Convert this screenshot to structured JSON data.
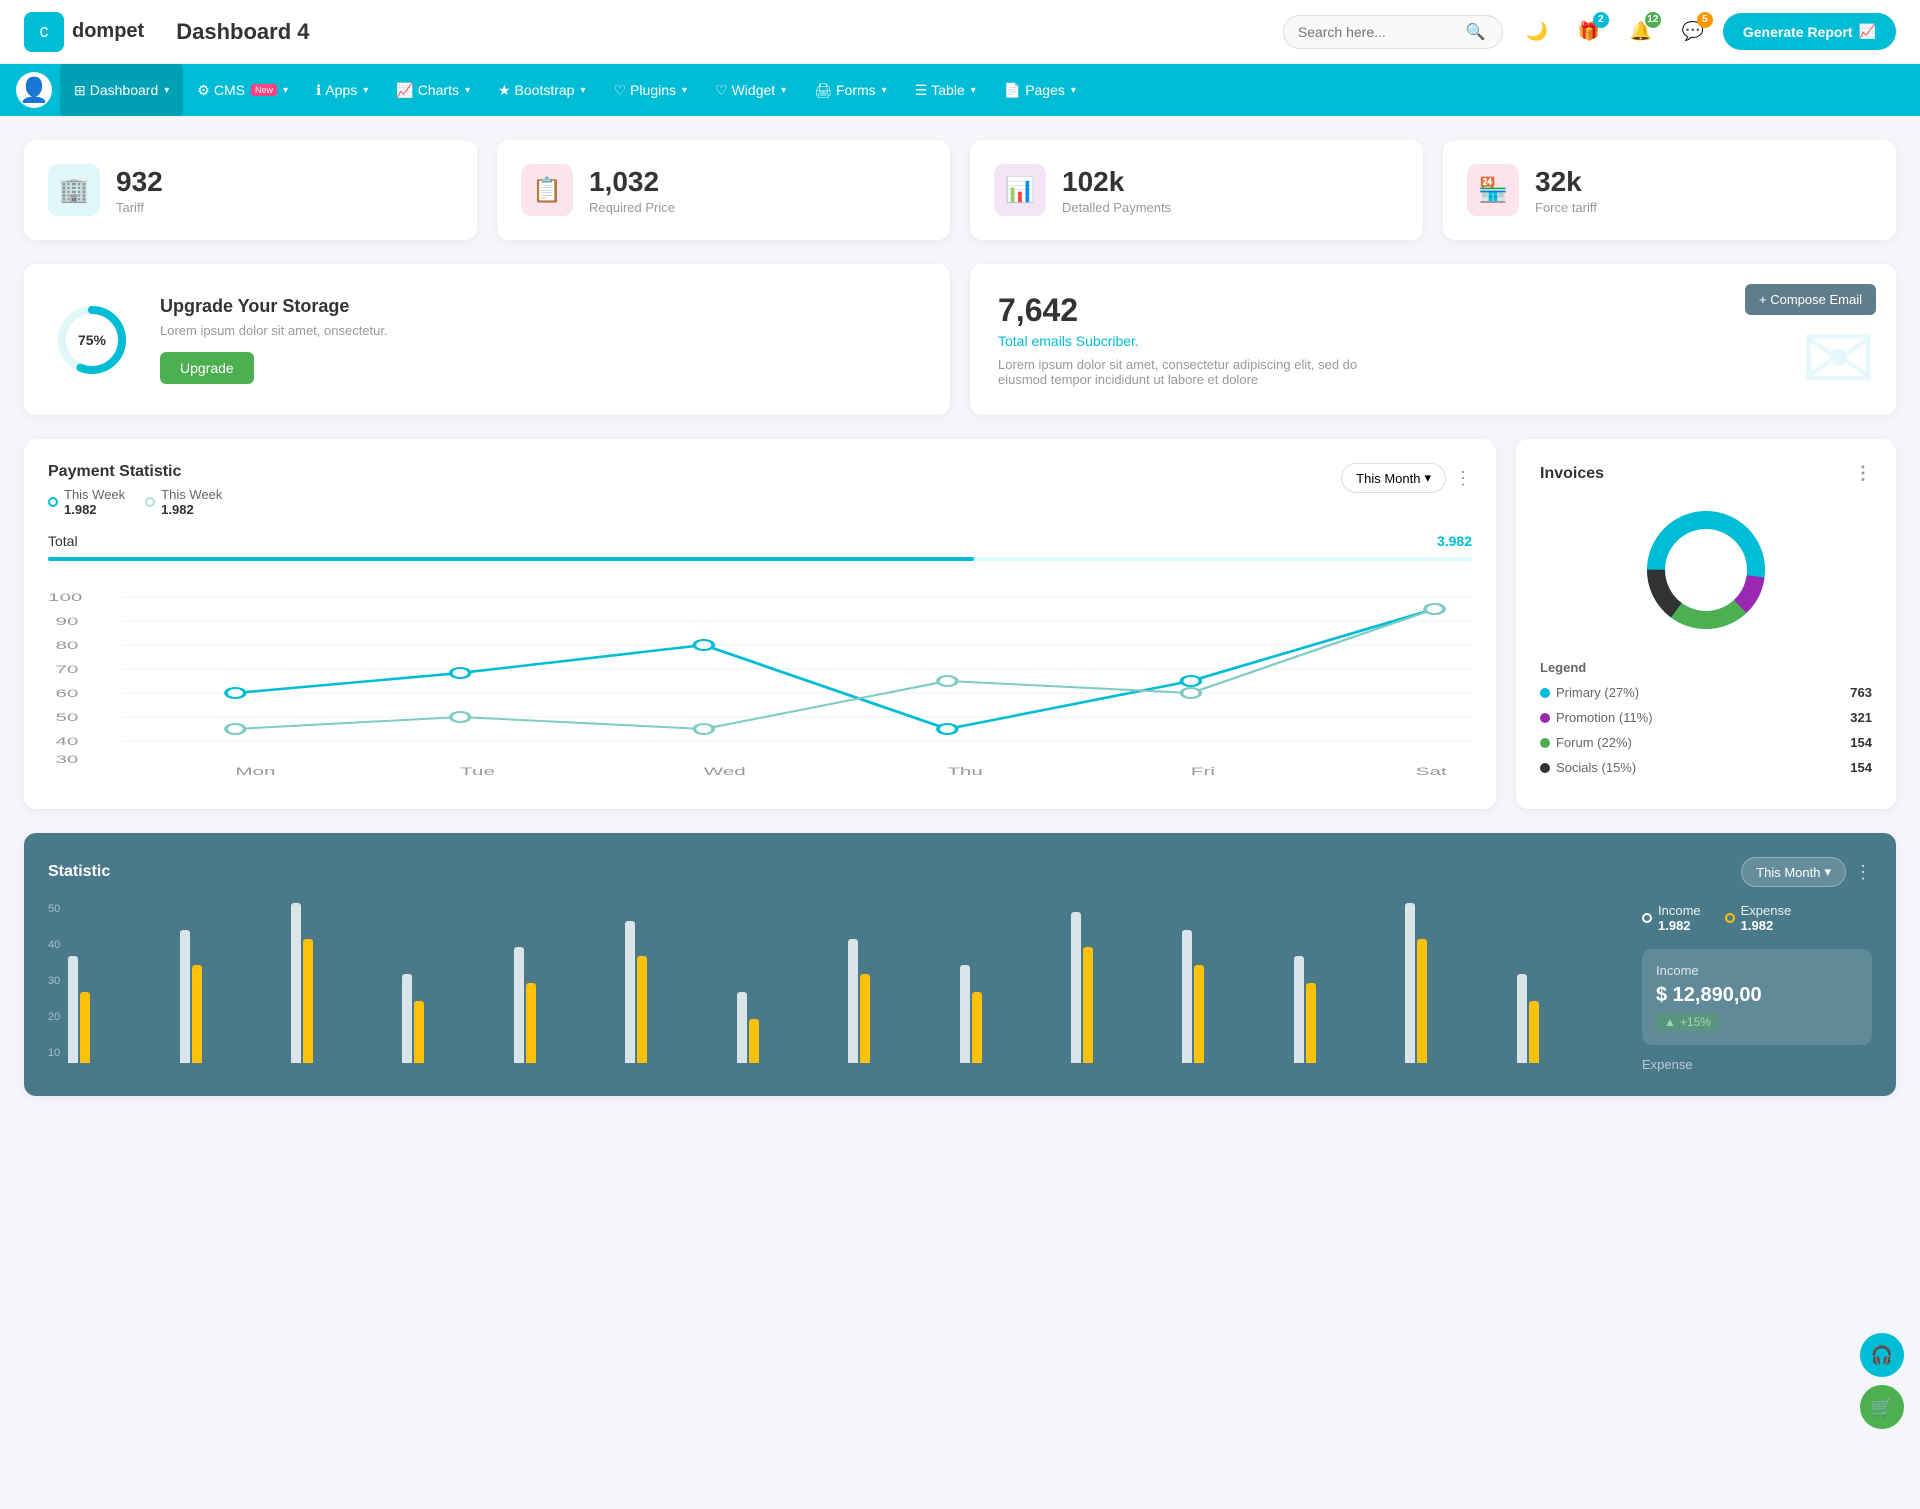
{
  "header": {
    "logo_icon": "💼",
    "logo_text": "dompet",
    "page_title": "Dashboard 4",
    "search_placeholder": "Search here...",
    "generate_btn": "Generate Report",
    "icons": {
      "moon": "🌙",
      "gift": "🎁",
      "bell": "🔔",
      "chat": "💬"
    },
    "badges": {
      "gift": "2",
      "bell": "12",
      "chat": "5"
    }
  },
  "nav": {
    "items": [
      {
        "label": "Dashboard",
        "active": true,
        "has_arrow": true
      },
      {
        "label": "CMS",
        "active": false,
        "has_arrow": true,
        "badge": "New"
      },
      {
        "label": "Apps",
        "active": false,
        "has_arrow": true
      },
      {
        "label": "Charts",
        "active": false,
        "has_arrow": true
      },
      {
        "label": "Bootstrap",
        "active": false,
        "has_arrow": true
      },
      {
        "label": "Plugins",
        "active": false,
        "has_arrow": true
      },
      {
        "label": "Widget",
        "active": false,
        "has_arrow": true
      },
      {
        "label": "Forms",
        "active": false,
        "has_arrow": true
      },
      {
        "label": "Table",
        "active": false,
        "has_arrow": true
      },
      {
        "label": "Pages",
        "active": false,
        "has_arrow": true
      }
    ]
  },
  "stat_cards": [
    {
      "value": "932",
      "label": "Tariff",
      "icon": "🏢",
      "color": "teal"
    },
    {
      "value": "1,032",
      "label": "Required Price",
      "icon": "📋",
      "color": "red"
    },
    {
      "value": "102k",
      "label": "Detalled Payments",
      "icon": "📊",
      "color": "purple"
    },
    {
      "value": "32k",
      "label": "Force tariff",
      "icon": "🏪",
      "color": "pink"
    }
  ],
  "storage": {
    "percent": 75,
    "percent_label": "75%",
    "title": "Upgrade Your Storage",
    "description": "Lorem ipsum dolor sit amet, onsectetur.",
    "btn_label": "Upgrade"
  },
  "email": {
    "number": "7,642",
    "subtitle": "Total emails Subcriber.",
    "description": "Lorem ipsum dolor sit amet, consectetur adipiscing elit, sed do eiusmod tempor incididunt ut labore et dolore",
    "compose_btn": "+ Compose Email"
  },
  "payment": {
    "title": "Payment Statistic",
    "legend": [
      {
        "label": "This Week",
        "value": "1.982",
        "color": "#00bcd4"
      },
      {
        "label": "This Week",
        "value": "1.982",
        "color": "#b2dfdb"
      }
    ],
    "filter_btn": "This Month",
    "total_label": "Total",
    "total_value": "3.982",
    "chart_data": {
      "labels": [
        "Mon",
        "Tue",
        "Wed",
        "Thu",
        "Fri",
        "Sat"
      ],
      "line1": [
        60,
        70,
        80,
        40,
        65,
        90
      ],
      "line2": [
        40,
        50,
        40,
        65,
        60,
        90
      ]
    },
    "y_labels": [
      "100",
      "90",
      "80",
      "70",
      "60",
      "50",
      "40",
      "30"
    ]
  },
  "invoices": {
    "title": "Invoices",
    "legend": [
      {
        "label": "Primary (27%)",
        "value": "763",
        "color": "#00bcd4"
      },
      {
        "label": "Promotion (11%)",
        "value": "321",
        "color": "#9c27b0"
      },
      {
        "label": "Forum (22%)",
        "value": "154",
        "color": "#4caf50"
      },
      {
        "label": "Socials (15%)",
        "value": "154",
        "color": "#333"
      }
    ]
  },
  "statistic": {
    "title": "Statistic",
    "filter_btn": "This Month",
    "income_label": "Income",
    "income_value": "1.982",
    "expense_label": "Expense",
    "expense_value": "1.982",
    "income_box": {
      "label": "Income",
      "amount": "$ 12,890,00",
      "badge": "+15%"
    },
    "y_labels": [
      "50",
      "40",
      "30",
      "20",
      "10"
    ],
    "bar_groups": [
      {
        "white": 60,
        "yellow": 40
      },
      {
        "white": 75,
        "yellow": 55
      },
      {
        "white": 90,
        "yellow": 70
      },
      {
        "white": 50,
        "yellow": 35
      },
      {
        "white": 65,
        "yellow": 45
      },
      {
        "white": 80,
        "yellow": 60
      },
      {
        "white": 40,
        "yellow": 25
      },
      {
        "white": 70,
        "yellow": 50
      },
      {
        "white": 55,
        "yellow": 40
      },
      {
        "white": 85,
        "yellow": 65
      },
      {
        "white": 75,
        "yellow": 55
      },
      {
        "white": 60,
        "yellow": 45
      },
      {
        "white": 90,
        "yellow": 70
      },
      {
        "white": 50,
        "yellow": 35
      }
    ]
  },
  "float_btns": {
    "headset": "🎧",
    "cart": "🛒"
  }
}
